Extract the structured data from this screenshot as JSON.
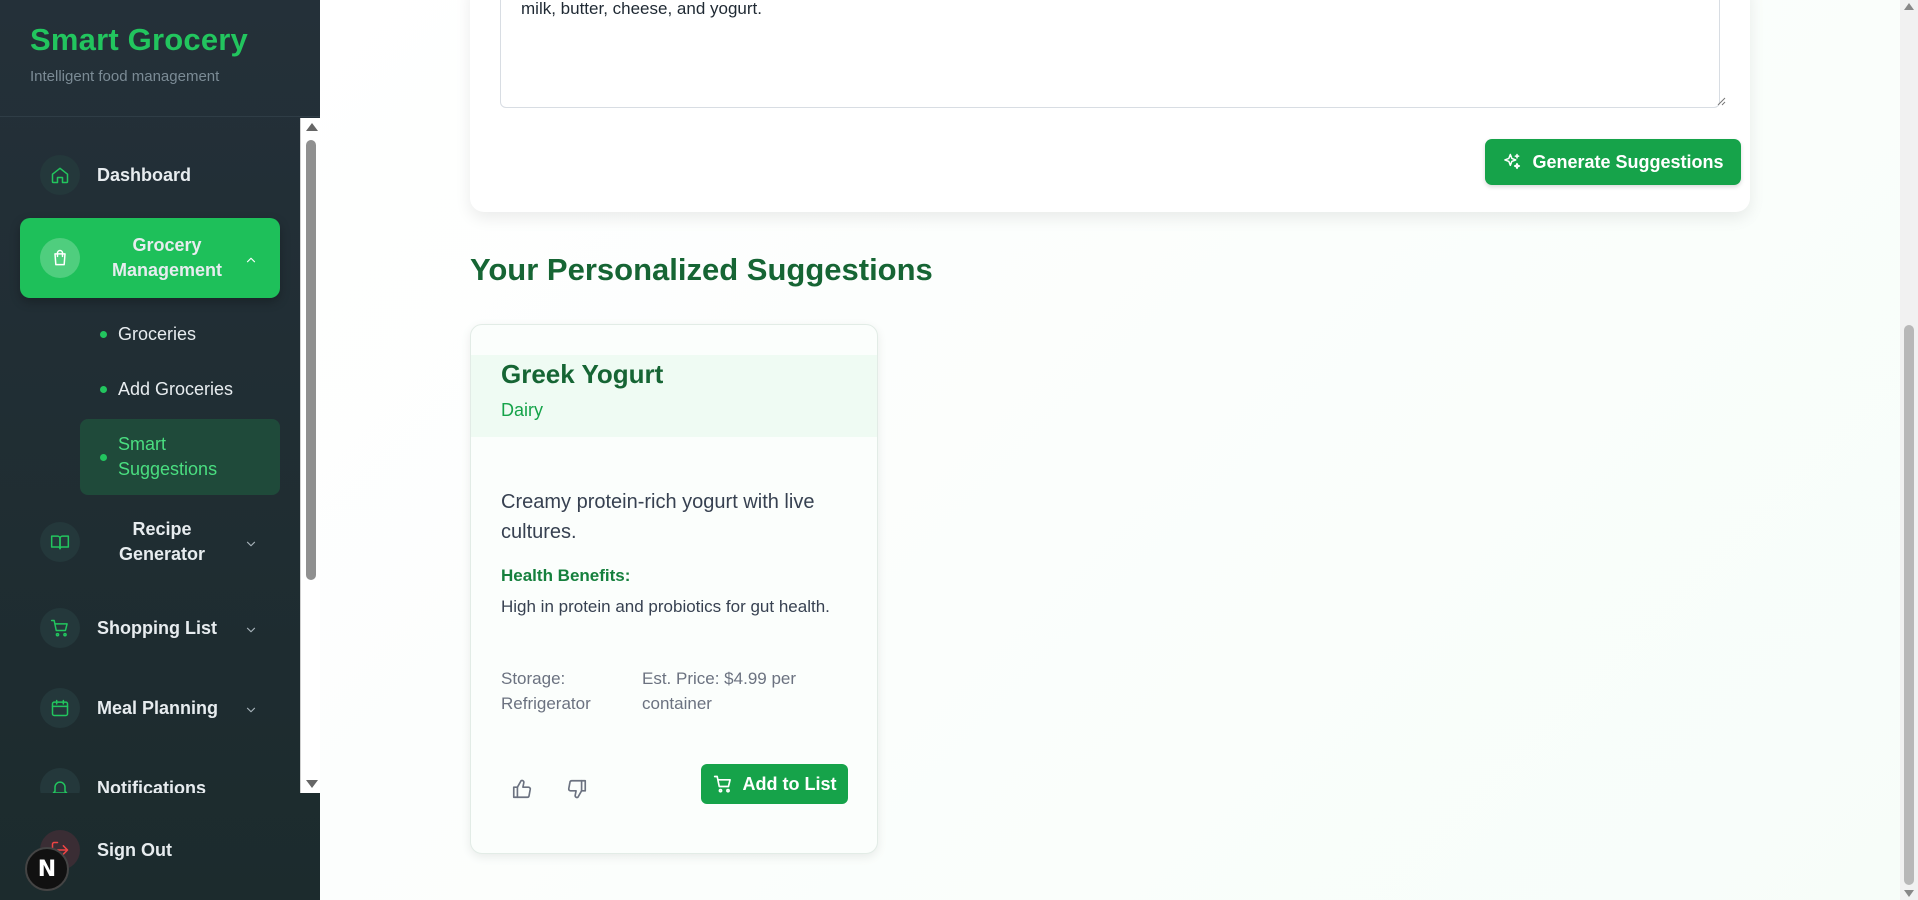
{
  "brand": {
    "title": "Smart Grocery",
    "subtitle": "Intelligent food management"
  },
  "sidebar": {
    "items": [
      {
        "label": "Dashboard",
        "icon": "home-icon"
      },
      {
        "label": "Grocery Management",
        "icon": "shopping-bag-icon",
        "expanded": true
      },
      {
        "label": "Recipe Generator",
        "icon": "book-icon"
      },
      {
        "label": "Shopping List",
        "icon": "cart-icon"
      },
      {
        "label": "Meal Planning",
        "icon": "calendar-icon"
      },
      {
        "label": "Notifications",
        "icon": "bell-icon"
      }
    ],
    "subitems": [
      {
        "label": "Groceries"
      },
      {
        "label": "Add Groceries"
      },
      {
        "label": "Smart Suggestions",
        "selected": true
      }
    ],
    "signout": "Sign Out",
    "framework_badge": "N"
  },
  "form": {
    "textarea_value": "milk, butter, cheese, and yogurt.",
    "generate_label": "Generate Suggestions"
  },
  "suggestions": {
    "title": "Your Personalized Suggestions",
    "items": [
      {
        "name": "Greek Yogurt",
        "category": "Dairy",
        "description": "Creamy protein-rich yogurt with live cultures.",
        "health_label": "Health Benefits:",
        "health_text": "High in protein and probiotics for gut health.",
        "storage": "Storage: Refrigerator",
        "price": "Est. Price: $4.99 per container",
        "add_label": "Add to List"
      }
    ]
  },
  "colors": {
    "accent": "#22c55e",
    "button": "#16a34a",
    "title": "#166534",
    "sidebar_bg": "#243039"
  }
}
